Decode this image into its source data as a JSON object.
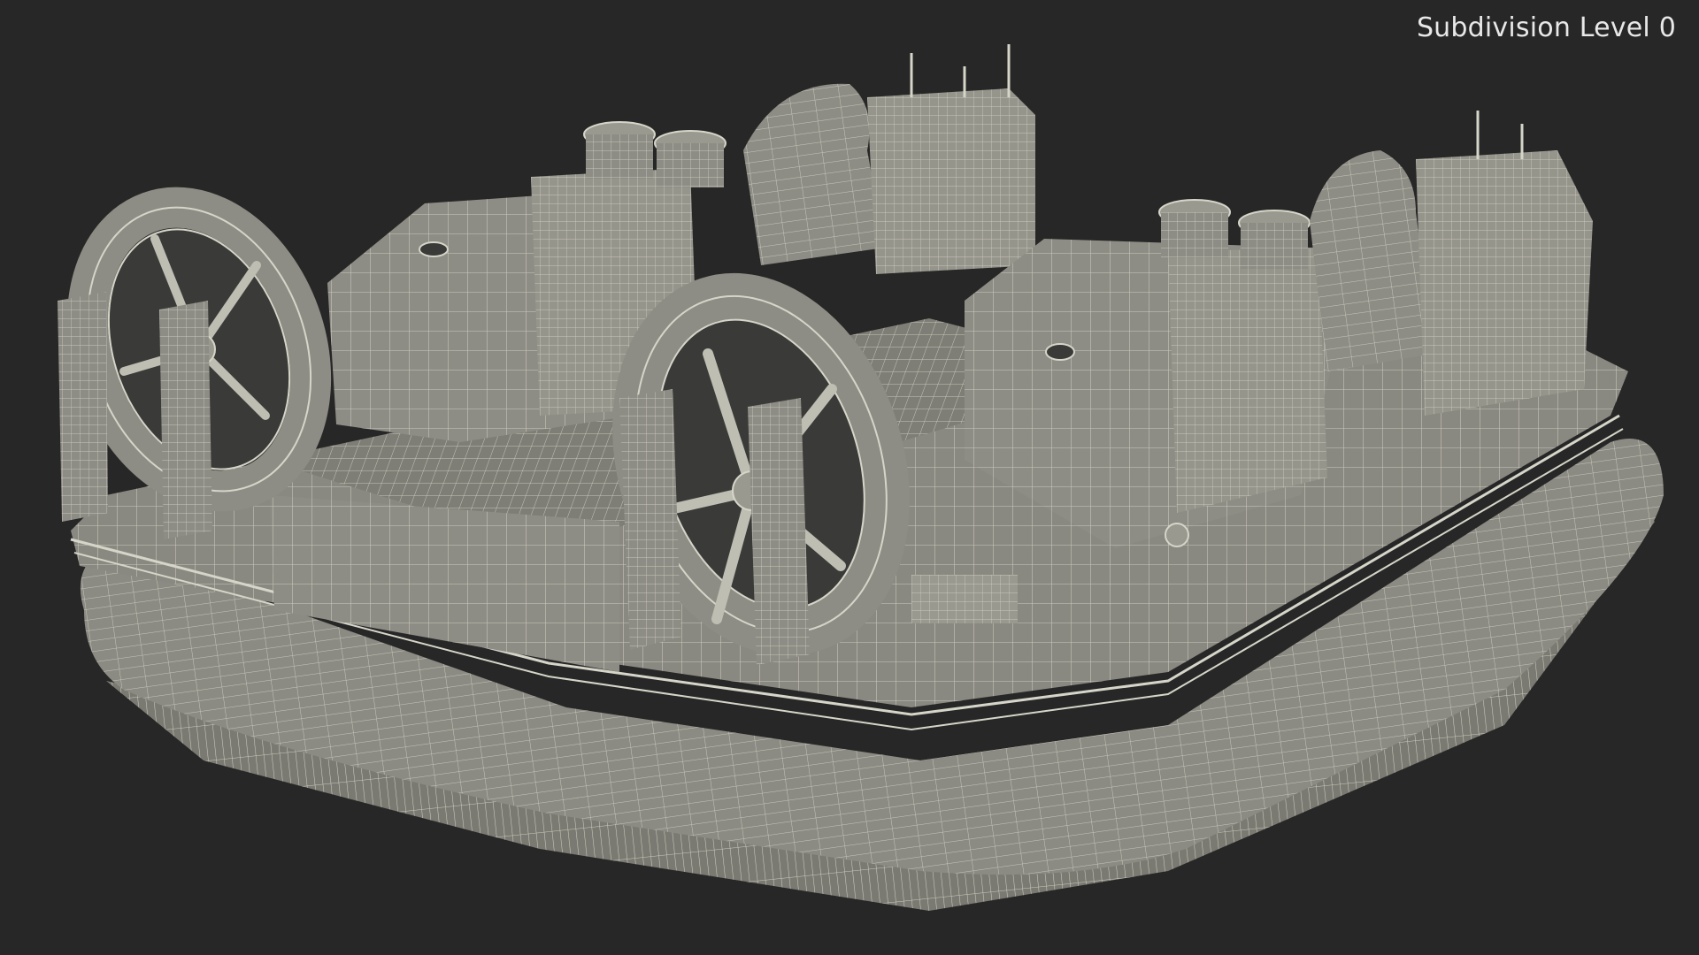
{
  "viewport": {
    "background_color": "#272727",
    "overlay_label": "Subdivision Level 0"
  },
  "render": {
    "subject": "hovercraft-wireframe-model",
    "surface_color": "#8c8b83",
    "wire_color": "#d6d5c9",
    "shadow_color": "#5f5e57"
  }
}
